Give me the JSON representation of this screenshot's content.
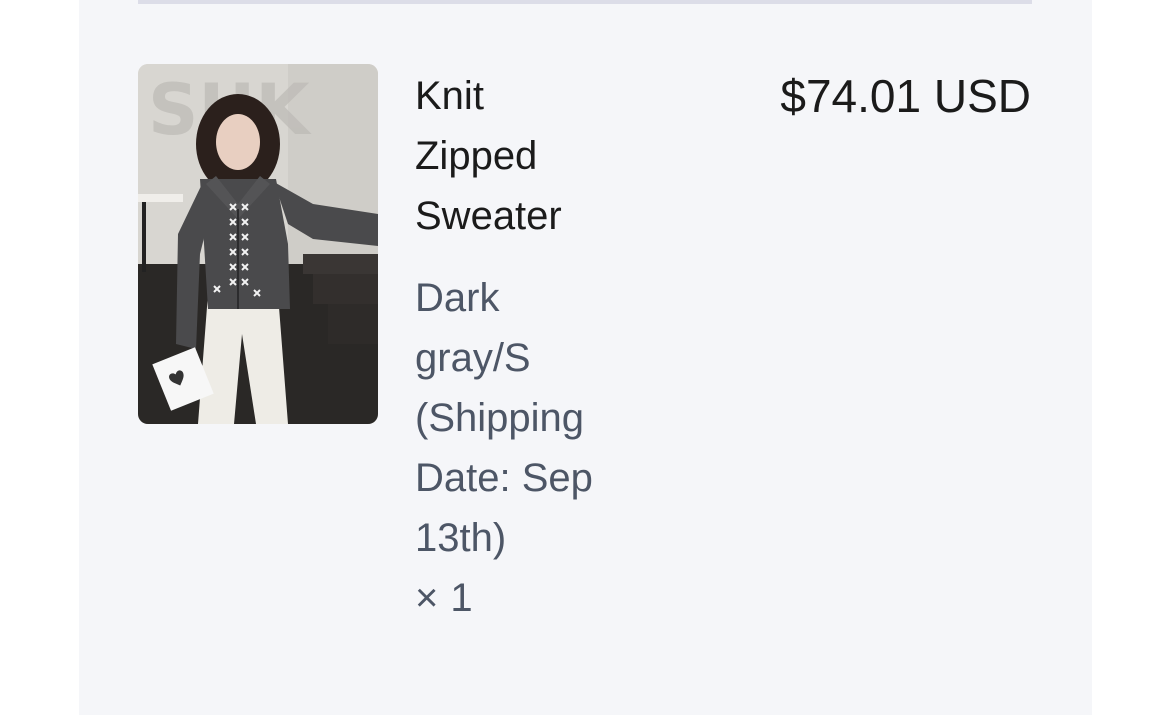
{
  "line_item": {
    "product_name": "Knit Zipped Sweater",
    "variant": "Dark gray/S (Shipping Date: Sep 13th)",
    "quantity_symbol": "×",
    "quantity": "1",
    "price": "$74.01 USD",
    "image_subject": "model-wearing-dark-gray-knit-zipped-sweater"
  },
  "colors": {
    "panel_bg": "#f5f6f9",
    "divider": "#dcdde8",
    "title_text": "#1b1b1b",
    "variant_text": "#4d5666"
  }
}
